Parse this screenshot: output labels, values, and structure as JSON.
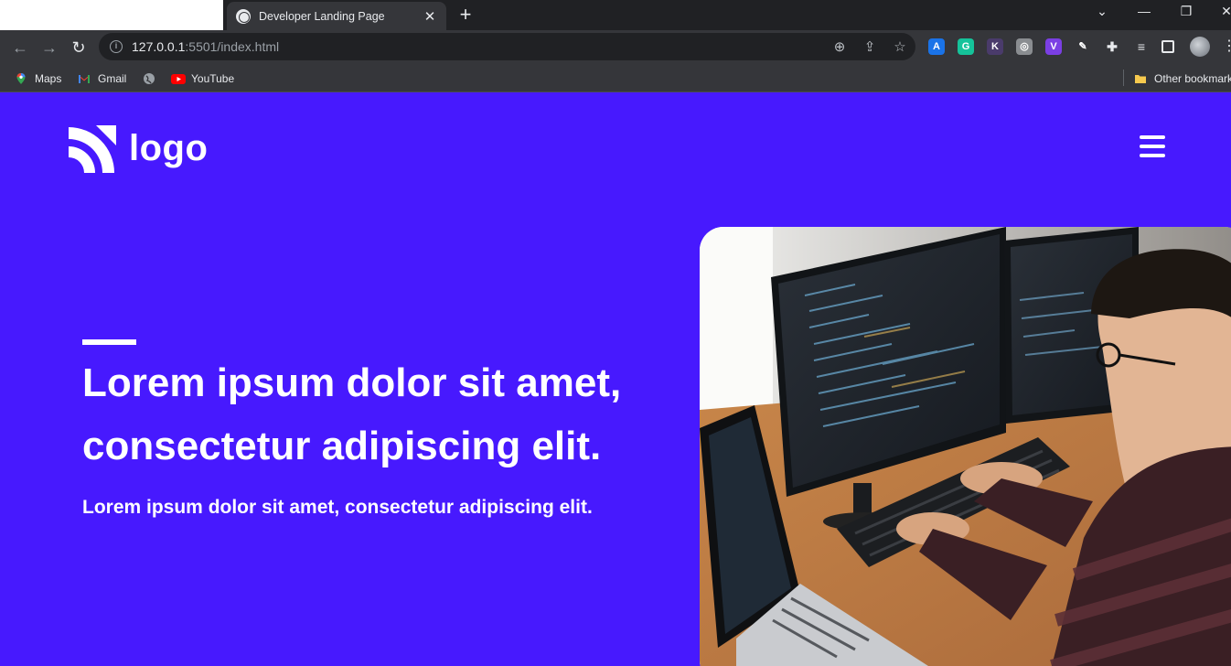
{
  "browser": {
    "tab_title": "Developer Landing Page",
    "url_host": "127.0.0.1",
    "url_rest": ":5501/index.html",
    "bookmarks": [
      {
        "label": "Maps",
        "icon": "maps-icon"
      },
      {
        "label": "Gmail",
        "icon": "gmail-icon"
      },
      {
        "label": "",
        "icon": "globe-icon"
      },
      {
        "label": "YouTube",
        "icon": "youtube-icon"
      }
    ],
    "other_bookmarks": "Other bookmarks",
    "extensions": [
      {
        "icon": "translate-extension-icon",
        "letter": "A",
        "color": "#1a73e8"
      },
      {
        "icon": "grammarly-extension-icon",
        "letter": "G",
        "color": "#15c39a"
      },
      {
        "icon": "k-extension-icon",
        "letter": "K",
        "color": "#4a3b6b"
      },
      {
        "icon": "capture-extension-icon",
        "letter": "◎",
        "color": "#8a8d91"
      },
      {
        "icon": "v-extension-icon",
        "letter": "V",
        "color": "#7b3fe4"
      },
      {
        "icon": "pen-extension-icon",
        "letter": "✎",
        "color": "#35363a"
      }
    ]
  },
  "page": {
    "logo_text": "logo",
    "hero_title": "Lorem ipsum dolor sit amet, consectetur adipiscing elit.",
    "hero_subtitle": "Lorem ipsum dolor sit amet, consectetur adipiscing elit.",
    "accent_color": "#4719fe"
  }
}
